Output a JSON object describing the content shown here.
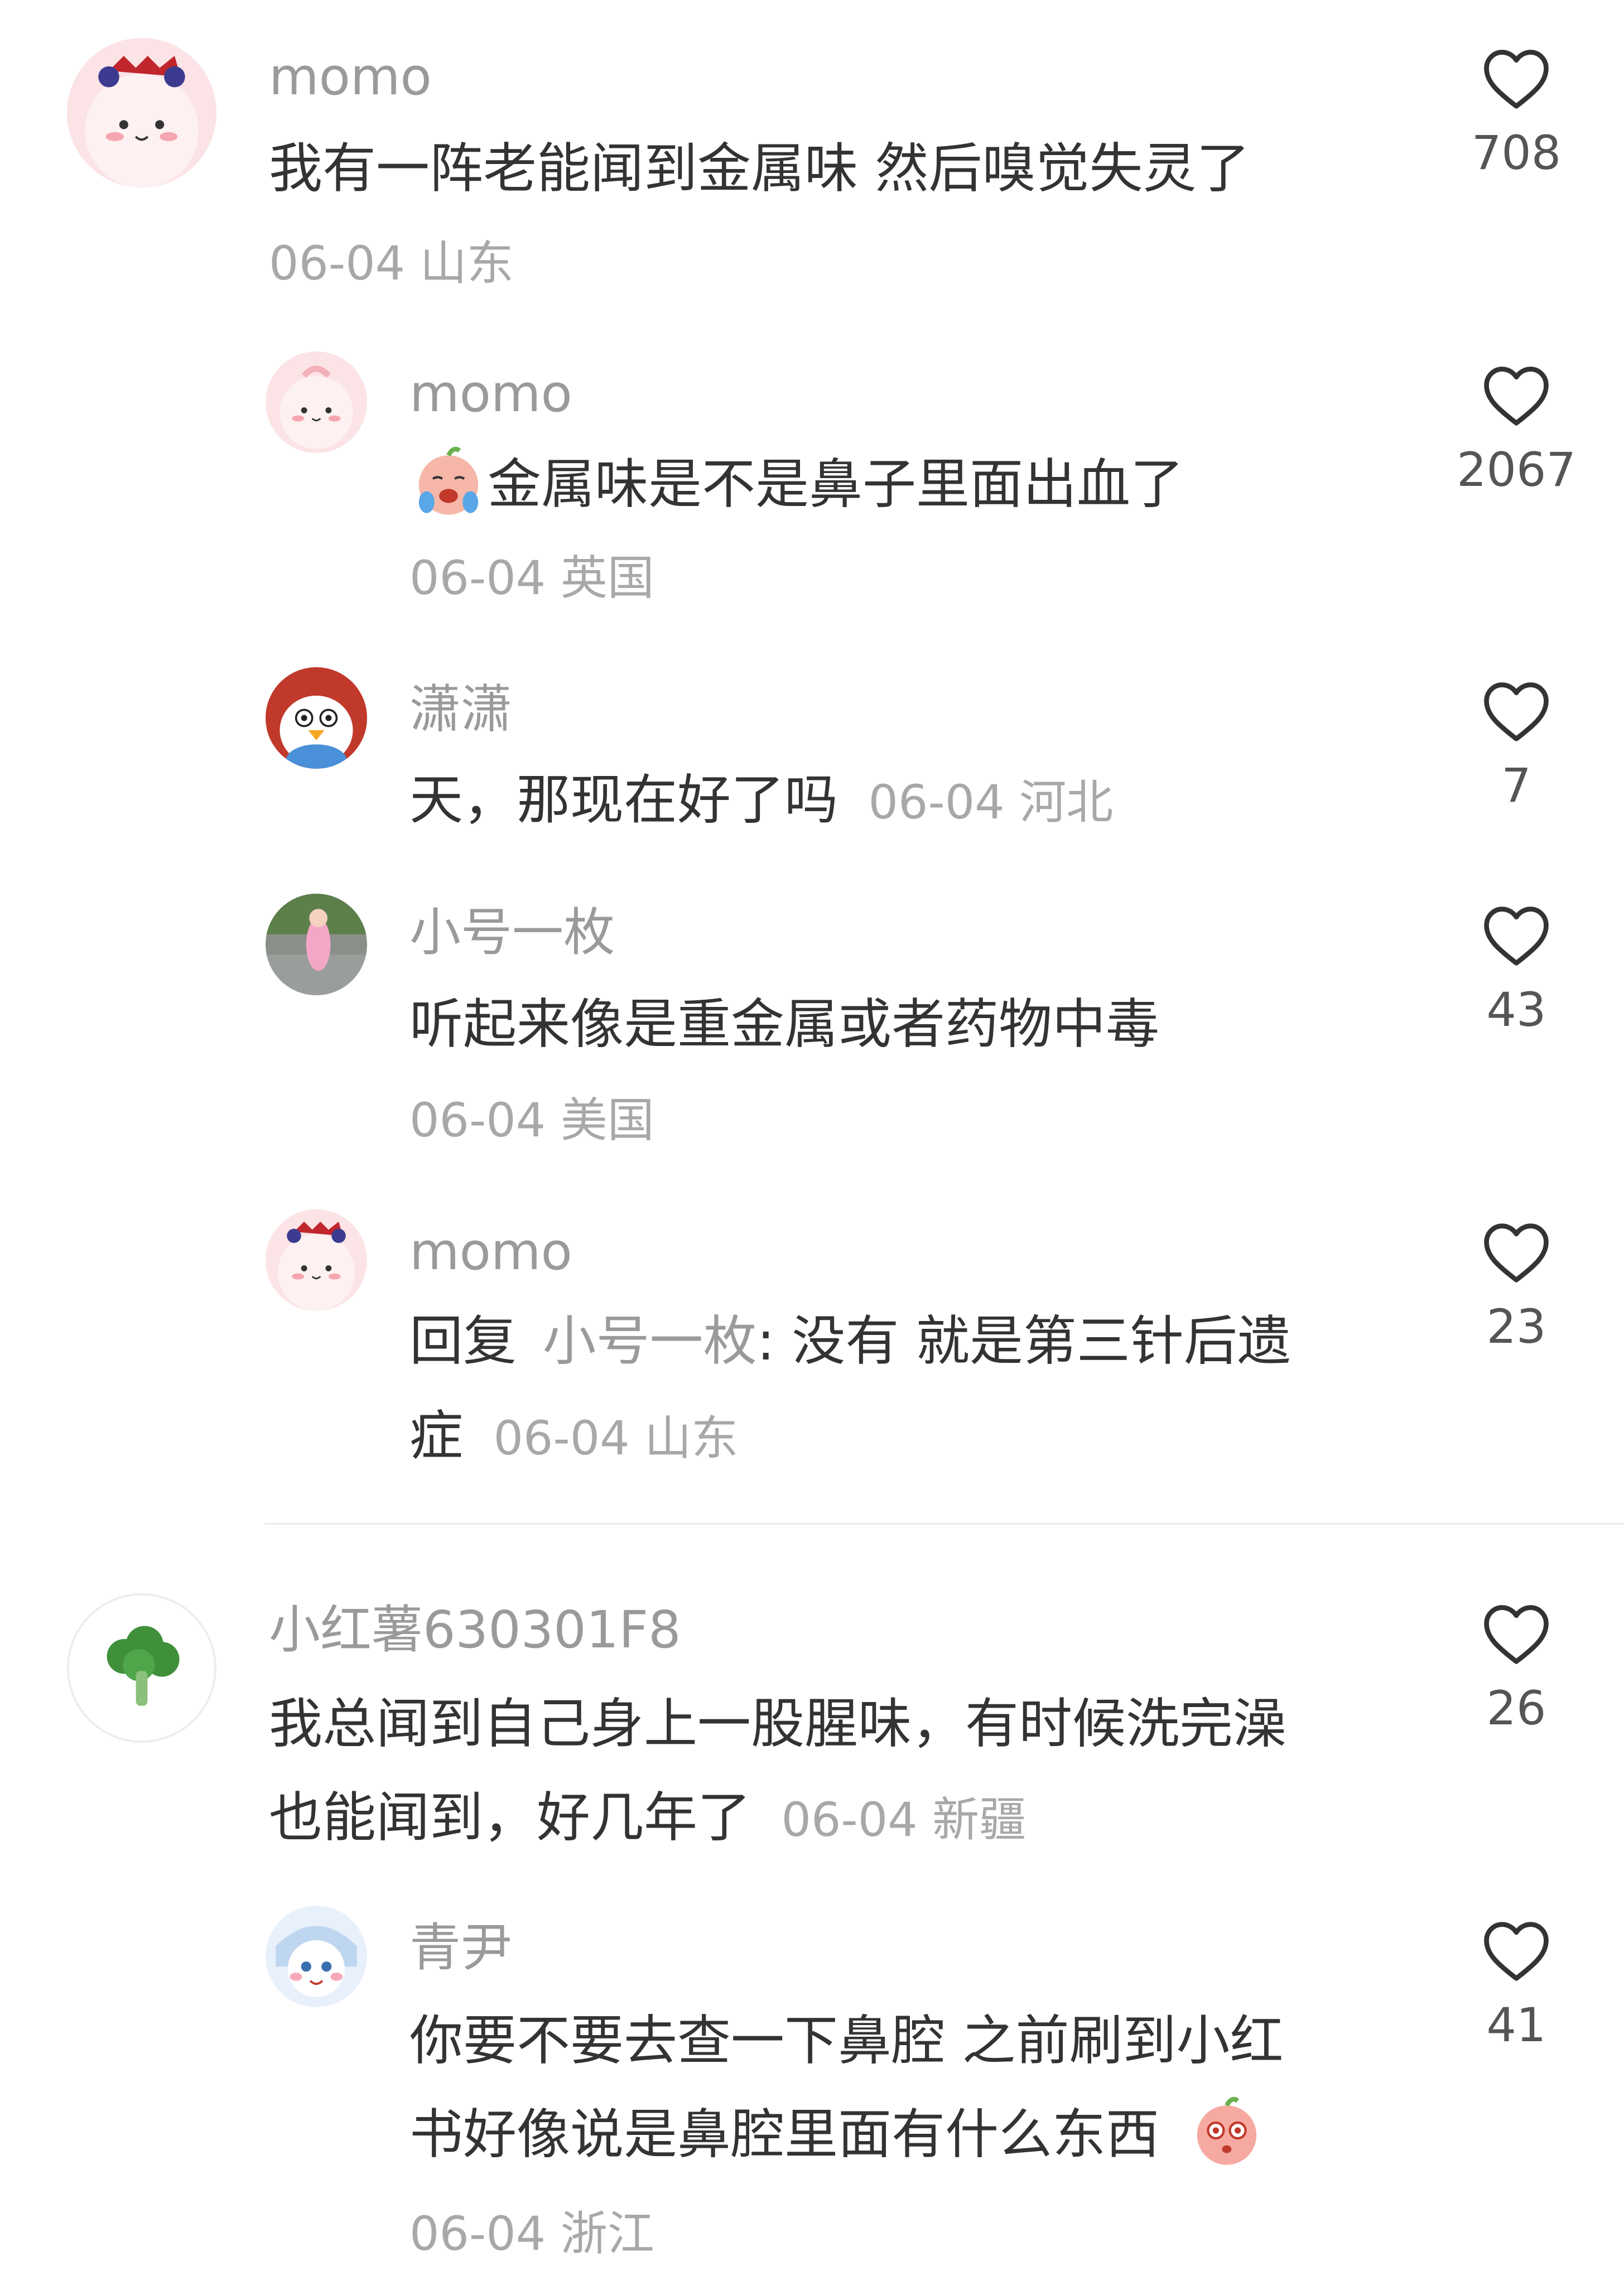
{
  "comments": [
    {
      "name": "momo",
      "text": "我有一阵老能闻到金属味 然后嗅觉失灵了",
      "meta": "06-04 山东",
      "likes": "708",
      "avatar_icon": "peach-character-crown-avatar"
    },
    {
      "name": "momo",
      "emoji_icon": "crying-peach-emoji",
      "text": "金属味是不是鼻子里面出血了",
      "meta": "06-04 英国",
      "likes": "2067",
      "avatar_icon": "peach-character-avatar"
    },
    {
      "name": "潇潇",
      "text": "天，那现在好了吗",
      "meta": "06-04 河北",
      "likes": "7",
      "avatar_icon": "penguin-cartoon-avatar"
    },
    {
      "name": "小号一枚",
      "text": "听起来像是重金属或者药物中毒",
      "meta": "06-04 美国",
      "likes": "43",
      "avatar_icon": "child-photo-avatar"
    },
    {
      "name": "momo",
      "reply_prefix": "回复",
      "reply_to": "小号一枚",
      "text_line1": ": 没有 就是第三针后遗",
      "text_line2": "症",
      "meta": "06-04 山东",
      "likes": "23",
      "avatar_icon": "peach-character-crown-avatar"
    },
    {
      "name": "小红薯630301F8",
      "text_line1": "我总闻到自己身上一股腥味，有时候洗完澡",
      "text_line2": "也能闻到，好几年了",
      "meta": "06-04 新疆",
      "likes": "26",
      "avatar_icon": "broccoli-avatar"
    },
    {
      "name": "青尹",
      "text_line1": "你要不要去查一下鼻腔 之前刷到小红",
      "text_line2": "书好像说是鼻腔里面有什么东西",
      "emoji_icon": "shocked-peach-emoji",
      "meta": "06-04 浙江",
      "likes": "41",
      "avatar_icon": "cartoon-girl-avatar"
    }
  ],
  "like_icon": "heart-outline-icon",
  "colors": {
    "name": "#9a9a9a",
    "text": "#333333",
    "meta": "#a8a8a8",
    "divider": "#ececec"
  }
}
